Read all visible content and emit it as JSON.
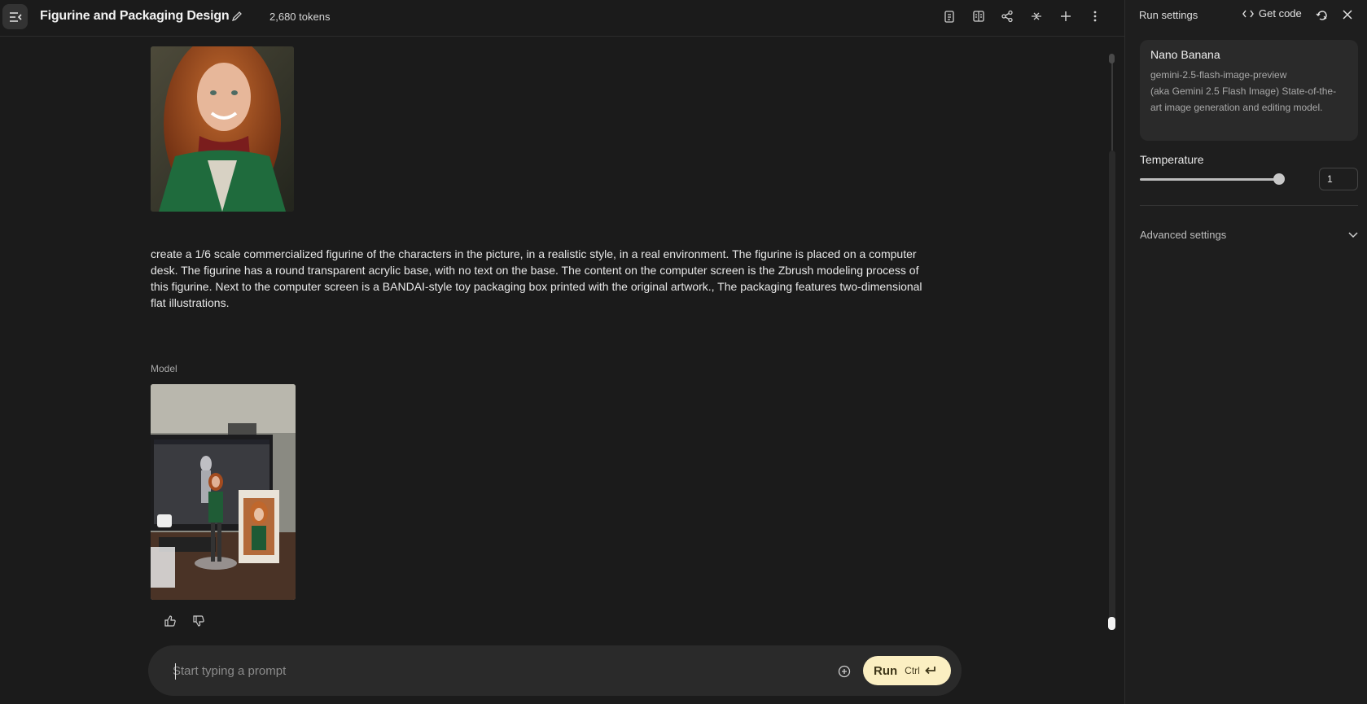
{
  "header": {
    "title": "Figurine and Packaging Design",
    "tokens": "2,680 tokens"
  },
  "chat": {
    "user_prompt": "create a 1/6 scale commercialized figurine of the characters in the picture, in a realistic style, in a real environment. The figurine is placed on a computer desk. The figurine has a round transparent acrylic base, with no text on the base. The content on the computer screen is the Zbrush modeling process of this figurine. Next to the computer screen is a BANDAI-style toy packaging box printed with the original artwork., The packaging features two-dimensional flat illustrations.",
    "model_label": "Model"
  },
  "input": {
    "placeholder": "Start typing a prompt",
    "run_label": "Run",
    "run_shortcut": "Ctrl"
  },
  "panel": {
    "title": "Run settings",
    "get_code": "Get code",
    "model_name": "Nano Banana",
    "model_id": "gemini-2.5-flash-image-preview",
    "model_desc": "(aka Gemini 2.5 Flash Image) State-of-the-art image generation and editing model.",
    "temperature_label": "Temperature",
    "temperature_value": "1",
    "temperature_fraction": 1.0,
    "advanced_label": "Advanced settings"
  },
  "colors": {
    "background": "#1b1b1b",
    "panel": "#1e1e1e",
    "run_button": "#fbefc2"
  }
}
